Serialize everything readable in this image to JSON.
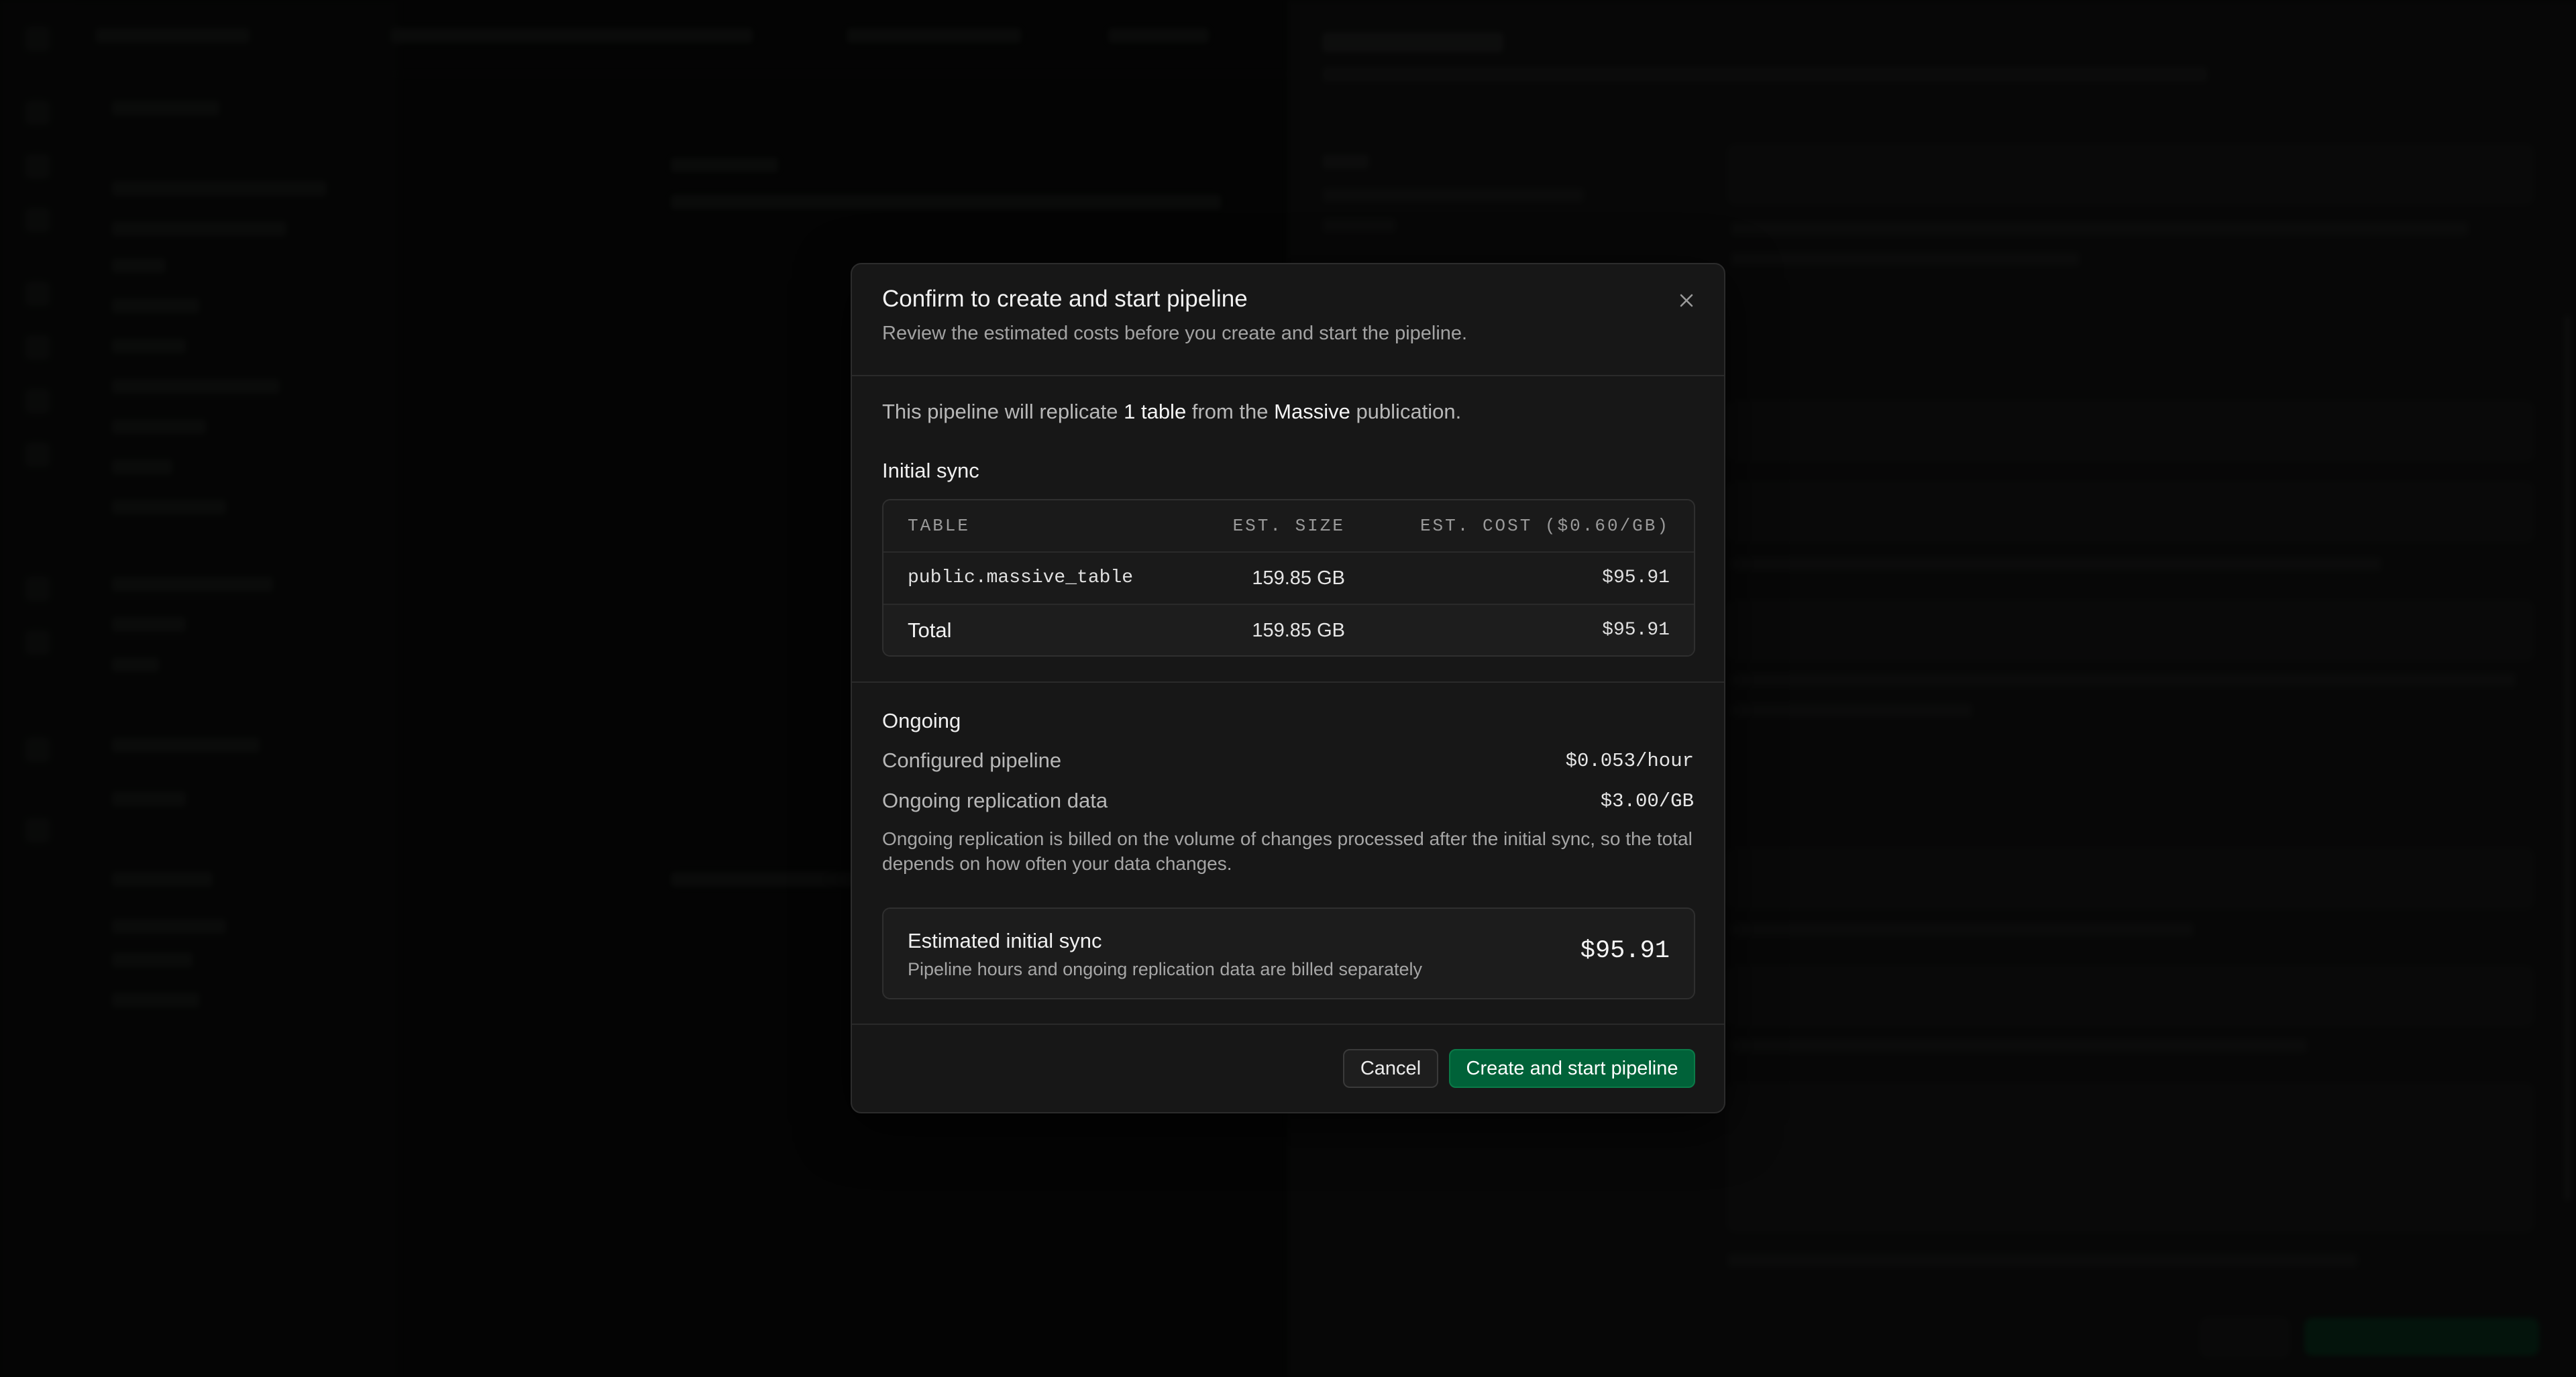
{
  "modal": {
    "title": "Confirm to create and start pipeline",
    "subtitle": "Review the estimated costs before you create and start the pipeline.",
    "close_icon": "close-icon",
    "intro": {
      "prefix": "This pipeline will replicate ",
      "table_count": "1 table",
      "middle": " from the ",
      "publication": "Massive",
      "suffix": " publication."
    },
    "initial_sync": {
      "title": "Initial sync",
      "columns": [
        "TABLE",
        "EST. SIZE",
        "EST. COST ($0.60/GB)"
      ],
      "rows": [
        {
          "table": "public.massive_table",
          "size": "159.85 GB",
          "cost": "$95.91"
        }
      ],
      "total": {
        "label": "Total",
        "size": "159.85 GB",
        "cost": "$95.91"
      }
    },
    "ongoing": {
      "title": "Ongoing",
      "items": [
        {
          "label": "Configured pipeline",
          "value": "$0.053/hour"
        },
        {
          "label": "Ongoing replication data",
          "value": "$3.00/GB"
        }
      ],
      "note": "Ongoing replication is billed on the volume of changes processed after the initial sync, so the total depends on how often your data changes."
    },
    "estimate": {
      "title": "Estimated initial sync",
      "subtitle": "Pipeline hours and ongoing replication data are billed separately",
      "value": "$95.91"
    },
    "buttons": {
      "cancel": "Cancel",
      "create": "Create and start pipeline"
    }
  },
  "colors": {
    "accent": "#006239",
    "modal_bg": "#171717",
    "overlay": "#000000"
  }
}
